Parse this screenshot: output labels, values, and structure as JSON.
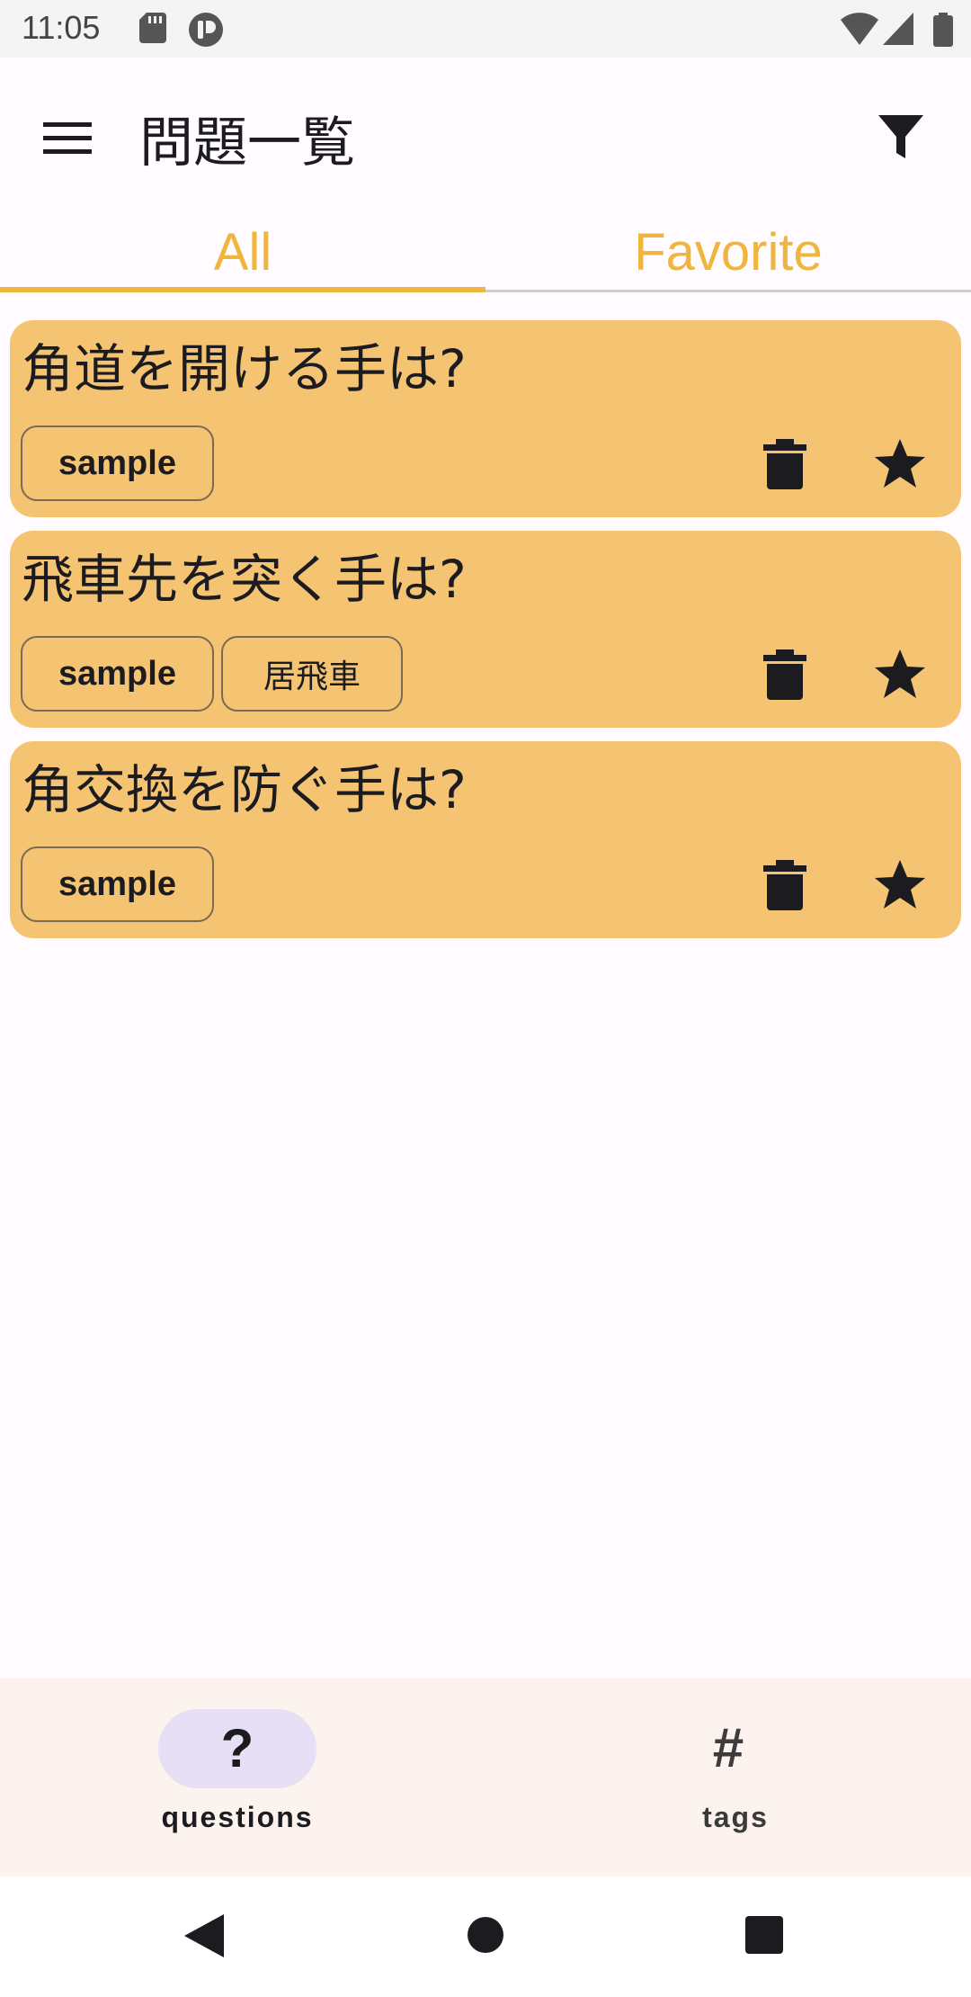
{
  "status_bar": {
    "time": "11:05",
    "left_icons": [
      "sd-card-icon",
      "app-notification-icon"
    ],
    "right_icons": [
      "wifi-icon",
      "cell-signal-icon",
      "battery-icon"
    ]
  },
  "app_bar": {
    "title": "問題一覧",
    "menu_icon": "hamburger-menu-icon",
    "filter_icon": "filter-icon"
  },
  "tabs": [
    {
      "label": "All",
      "selected": true
    },
    {
      "label": "Favorite",
      "selected": false
    }
  ],
  "colors": {
    "accent": "#f0b53e",
    "card": "#f4c472",
    "background": "#fffbfe",
    "nav_background": "#fdf3ee",
    "nav_indicator": "#e7dff5"
  },
  "questions": [
    {
      "title": "角道を開ける手は?",
      "tags": [
        "sample"
      ]
    },
    {
      "title": "飛車先を突く手は?",
      "tags": [
        "sample",
        "居飛車"
      ]
    },
    {
      "title": "角交換を防ぐ手は?",
      "tags": [
        "sample"
      ]
    }
  ],
  "bottom_nav": [
    {
      "label": "questions",
      "icon": "?",
      "selected": true
    },
    {
      "label": "tags",
      "icon": "#",
      "selected": false
    }
  ],
  "system_nav": [
    "back-icon",
    "home-icon",
    "recents-icon"
  ]
}
